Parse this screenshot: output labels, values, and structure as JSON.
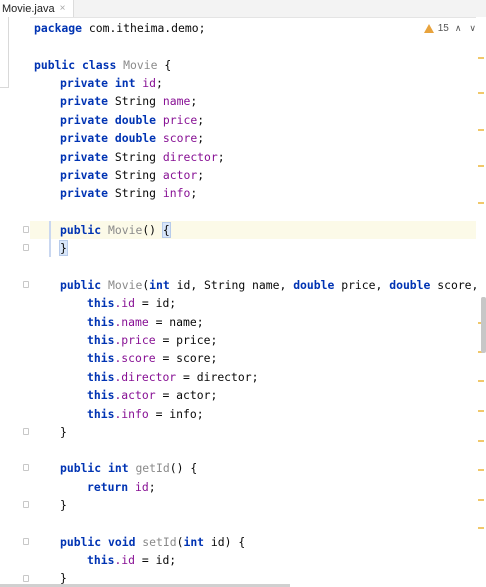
{
  "tab": {
    "file_name": "Movie.java",
    "close_glyph": "×"
  },
  "inspections": {
    "warning_count": "15",
    "prev_glyph": "∧",
    "next_glyph": "∨",
    "warning_icon": "warning-triangle-icon"
  },
  "colors": {
    "keyword": "#0033b3",
    "field": "#871094",
    "method": "#8a8a8a",
    "text": "#080808",
    "warning": "#e8a33d",
    "caret_row": "#fcfae8"
  },
  "code": {
    "package_kw": "package",
    "package_name": " com.itheima.demo;",
    "class_public": "public",
    "class_kw": " class",
    "class_name": " Movie",
    "class_open": " {",
    "fields": [
      {
        "mod": "private",
        "type_kw": " int",
        "type": "",
        "name": " id",
        "semi": ";"
      },
      {
        "mod": "private",
        "type_kw": "",
        "type": " String",
        "name": " name",
        "semi": ";"
      },
      {
        "mod": "private",
        "type_kw": " double",
        "type": "",
        "name": " price",
        "semi": ";"
      },
      {
        "mod": "private",
        "type_kw": " double",
        "type": "",
        "name": " score",
        "semi": ";"
      },
      {
        "mod": "private",
        "type_kw": "",
        "type": " String",
        "name": " director",
        "semi": ";"
      },
      {
        "mod": "private",
        "type_kw": "",
        "type": " String",
        "name": " actor",
        "semi": ";"
      },
      {
        "mod": "private",
        "type_kw": "",
        "type": " String",
        "name": " info",
        "semi": ";"
      }
    ],
    "ctor1_public": "public",
    "ctor1_name": " Movie",
    "ctor1_parens": "() ",
    "ctor1_open": "{",
    "ctor1_close": "}",
    "ctor2_public": "public",
    "ctor2_name": " Movie",
    "ctor2_p1": "(",
    "ctor2_int": "int",
    "ctor2_p2": " id, String name, ",
    "ctor2_double1": "double",
    "ctor2_p3": " price, ",
    "ctor2_double2": "double",
    "ctor2_p4": " score, St",
    "assigns": [
      {
        "this": "this",
        "field": ".id",
        "rest": " = id;"
      },
      {
        "this": "this",
        "field": ".name",
        "rest": " = name;"
      },
      {
        "this": "this",
        "field": ".price",
        "rest": " = price;"
      },
      {
        "this": "this",
        "field": ".score",
        "rest": " = score;"
      },
      {
        "this": "this",
        "field": ".director",
        "rest": " = director;"
      },
      {
        "this": "this",
        "field": ".actor",
        "rest": " = actor;"
      },
      {
        "this": "this",
        "field": ".info",
        "rest": " = info;"
      }
    ],
    "ctor2_close": "}",
    "getid_public": "public",
    "getid_int": " int",
    "getid_name": " getId",
    "getid_rest": "() {",
    "return_kw": "return",
    "return_field": " id",
    "return_semi": ";",
    "getid_close": "}",
    "setid_public": "public",
    "setid_void": " void",
    "setid_name": " setId",
    "setid_p1": "(",
    "setid_int": "int",
    "setid_p2": " id) {",
    "setid_this": "this",
    "setid_field": ".id",
    "setid_rest": " = id;",
    "setid_close": "}"
  }
}
